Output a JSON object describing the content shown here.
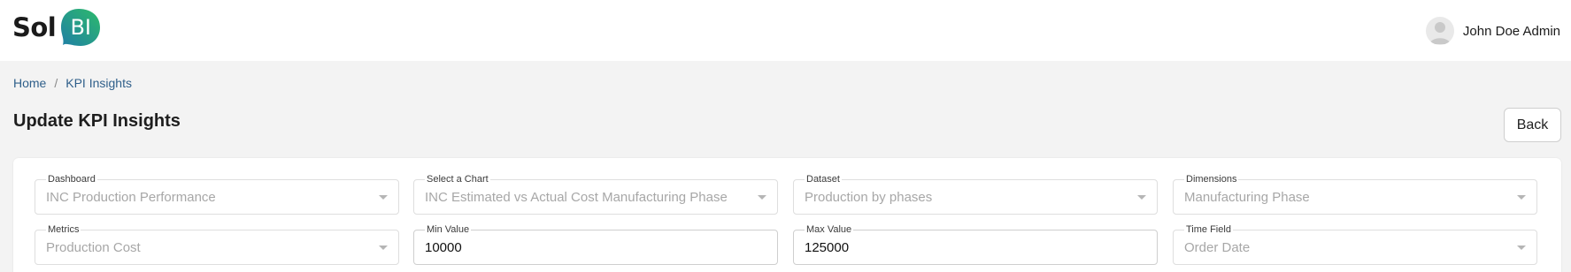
{
  "app": {
    "logo_text": "Sol",
    "logo_badge": "BI",
    "brand_gradient": [
      "#1f8aa8",
      "#2bb76c"
    ]
  },
  "user": {
    "name": "John Doe Admin",
    "avatar_icon": "user-avatar-icon"
  },
  "breadcrumb": {
    "items": [
      "Home",
      "KPI Insights"
    ],
    "separator": "/"
  },
  "page": {
    "title": "Update KPI Insights",
    "back_label": "Back"
  },
  "form": {
    "dashboard": {
      "label": "Dashboard",
      "value": "INC Production Performance",
      "disabled": true
    },
    "chart": {
      "label": "Select a Chart",
      "value": "INC Estimated vs Actual Cost Manufacturing Phase",
      "disabled": true
    },
    "dataset": {
      "label": "Dataset",
      "value": "Production by phases",
      "disabled": true
    },
    "dimensions": {
      "label": "Dimensions",
      "value": "Manufacturing Phase",
      "disabled": true
    },
    "metrics": {
      "label": "Metrics",
      "value": "Production Cost",
      "disabled": true
    },
    "min_value": {
      "label": "Min Value",
      "value": "10000"
    },
    "max_value": {
      "label": "Max Value",
      "value": "125000"
    },
    "time_field": {
      "label": "Time Field",
      "value": "Order Date",
      "disabled": true
    }
  }
}
